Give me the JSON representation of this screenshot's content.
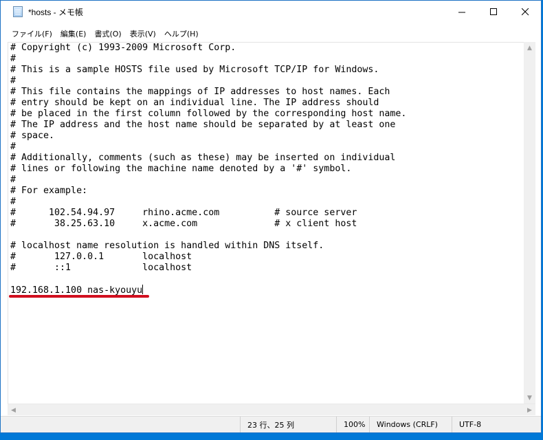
{
  "window": {
    "title": "*hosts - メモ帳",
    "controls": {
      "minimize": "—",
      "maximize": "☐",
      "close": "✕"
    }
  },
  "menu": {
    "items": [
      "ファイル(F)",
      "編集(E)",
      "書式(O)",
      "表示(V)",
      "ヘルプ(H)"
    ]
  },
  "editor": {
    "lines": [
      "# Copyright (c) 1993-2009 Microsoft Corp.",
      "#",
      "# This is a sample HOSTS file used by Microsoft TCP/IP for Windows.",
      "#",
      "# This file contains the mappings of IP addresses to host names. Each",
      "# entry should be kept on an individual line. The IP address should",
      "# be placed in the first column followed by the corresponding host name.",
      "# The IP address and the host name should be separated by at least one",
      "# space.",
      "#",
      "# Additionally, comments (such as these) may be inserted on individual",
      "# lines or following the machine name denoted by a '#' symbol.",
      "#",
      "# For example:",
      "#",
      "#      102.54.94.97     rhino.acme.com          # source server",
      "#       38.25.63.10     x.acme.com              # x client host",
      "",
      "# localhost name resolution is handled within DNS itself.",
      "#       127.0.0.1       localhost",
      "#       ::1             localhost",
      "",
      "192.168.1.100 nas-kyouyu"
    ],
    "highlight_color": "#d10f1f"
  },
  "statusbar": {
    "position": "23 行、25 列",
    "zoom": "100%",
    "line_ending": "Windows (CRLF)",
    "encoding": "UTF-8"
  },
  "colors": {
    "desktop": "#0078d7",
    "window_border": "#1c72c4"
  }
}
